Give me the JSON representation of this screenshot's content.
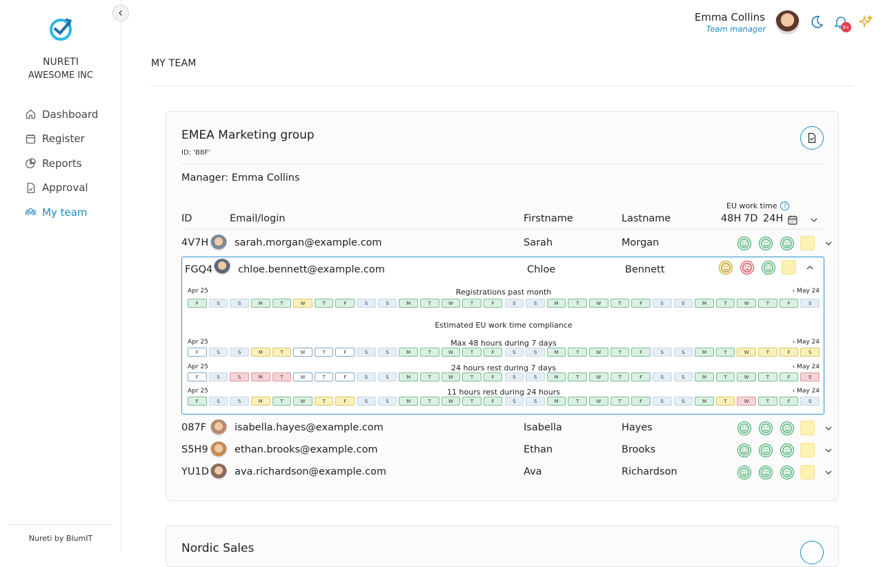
{
  "sidebar": {
    "org_line1": "NURETI",
    "org_line2": "AWESOME INC",
    "items": [
      {
        "label": "Dashboard",
        "icon": "home-icon"
      },
      {
        "label": "Register",
        "icon": "calendar-icon"
      },
      {
        "label": "Reports",
        "icon": "pie-chart-icon"
      },
      {
        "label": "Approval",
        "icon": "document-check-icon"
      },
      {
        "label": "My team",
        "icon": "team-icon",
        "active": true
      }
    ],
    "footer": "Nureti by BlumIT"
  },
  "header": {
    "user_name": "Emma Collins",
    "user_role": "Team manager",
    "notification_badge": "9+"
  },
  "page": {
    "title": "MY TEAM"
  },
  "group": {
    "title": "EMEA Marketing group",
    "id_text": "ID: 'B8F'",
    "manager": "Manager: Emma Collins",
    "eu_label": "EU work time",
    "columns": {
      "id": "ID",
      "email": "Email/login",
      "firstname": "Firstname",
      "lastname": "Lastname",
      "h48": "48H",
      "d7": "7D",
      "h24": "24H"
    },
    "members": [
      {
        "id": "4V7H",
        "email": "sarah.morgan@example.com",
        "first": "Sarah",
        "last": "Morgan",
        "status": [
          "happy",
          "happy",
          "happy"
        ]
      },
      {
        "id": "FGQ4",
        "email": "chloe.bennett@example.com",
        "first": "Chloe",
        "last": "Bennett",
        "status": [
          "neutral",
          "sad",
          "happy"
        ],
        "expanded": true
      },
      {
        "id": "087F",
        "email": "isabella.hayes@example.com",
        "first": "Isabella",
        "last": "Hayes",
        "status": [
          "happy",
          "happy",
          "happy"
        ]
      },
      {
        "id": "S5H9",
        "email": "ethan.brooks@example.com",
        "first": "Ethan",
        "last": "Brooks",
        "status": [
          "happy",
          "happy",
          "happy"
        ]
      },
      {
        "id": "YU1D",
        "email": "ava.richardson@example.com",
        "first": "Ava",
        "last": "Richardson",
        "status": [
          "happy",
          "happy",
          "happy"
        ]
      }
    ],
    "details": {
      "start": "Apr 25",
      "end": "‹ May 24",
      "registrations_title": "Registrations past month",
      "compliance_title": "Estimated EU work time compliance",
      "days": [
        "F",
        "S",
        "S",
        "M",
        "T",
        "W",
        "T",
        "F",
        "S",
        "S",
        "M",
        "T",
        "W",
        "T",
        "F",
        "S",
        "S",
        "M",
        "T",
        "W",
        "T",
        "F",
        "S",
        "S",
        "M",
        "T",
        "W",
        "T",
        "F",
        "S"
      ],
      "strips": [
        {
          "title": "Registrations past month",
          "states": [
            "g",
            "we",
            "we",
            "g",
            "g",
            "y",
            "g",
            "g",
            "we",
            "we",
            "g",
            "g",
            "g",
            "g",
            "g",
            "we",
            "we",
            "g",
            "g",
            "g",
            "g",
            "g",
            "we",
            "we",
            "g",
            "g",
            "g",
            "g",
            "g",
            "we"
          ]
        },
        {
          "title": "Max 48 hours during 7 days",
          "states": [
            "w",
            "we",
            "we",
            "y",
            "y",
            "w",
            "w",
            "w",
            "we",
            "we",
            "g",
            "g",
            "g",
            "g",
            "g",
            "we",
            "we",
            "g",
            "g",
            "g",
            "g",
            "g",
            "we",
            "we",
            "g",
            "g",
            "y",
            "y",
            "y",
            "y"
          ]
        },
        {
          "title": "24 hours rest during 7 days",
          "states": [
            "w",
            "we",
            "r",
            "r",
            "r",
            "w",
            "w",
            "w",
            "we",
            "we",
            "g",
            "g",
            "g",
            "g",
            "g",
            "we",
            "we",
            "g",
            "g",
            "g",
            "g",
            "g",
            "we",
            "we",
            "g",
            "g",
            "g",
            "g",
            "g",
            "r"
          ]
        },
        {
          "title": "11 hours rest during 24 hours",
          "states": [
            "g",
            "we",
            "we",
            "y",
            "g",
            "g",
            "y",
            "y",
            "we",
            "we",
            "g",
            "g",
            "g",
            "g",
            "g",
            "we",
            "we",
            "g",
            "g",
            "g",
            "g",
            "g",
            "we",
            "we",
            "g",
            "y",
            "r",
            "g",
            "g",
            "we"
          ]
        }
      ]
    }
  },
  "group2": {
    "title": "Nordic Sales"
  },
  "colors": {
    "accent": "#1c8ac7",
    "ok": "#3aa565",
    "warn": "#c9a21a",
    "bad": "#d64a55"
  }
}
